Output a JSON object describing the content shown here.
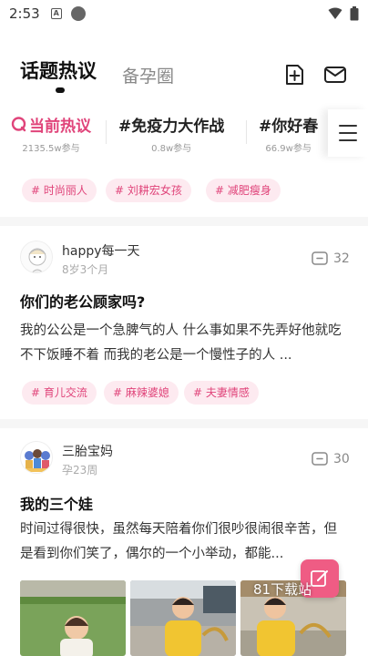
{
  "status_bar": {
    "time": "2:53",
    "a_badge": "A"
  },
  "header": {
    "active_tab": "话题热议",
    "second_tab": "备孕圈"
  },
  "topics": [
    {
      "title": "当前热议",
      "sub": "2135.5w参与"
    },
    {
      "title": "#免疫力大作战",
      "sub": "0.8w参与"
    },
    {
      "title": "#你好春",
      "sub": "66.9w参与"
    }
  ],
  "top_tags": [
    "# 时尚丽人",
    "# 刘耕宏女孩",
    "# 减肥瘦身"
  ],
  "posts": [
    {
      "author": "happy每一天",
      "sub": "8岁3个月",
      "comments": "32",
      "title": "你们的老公顾家吗?",
      "body": "我的公公是一个急脾气的人 什么事如果不先弄好他就吃不下饭睡不着 而我的老公是一个慢性子的人 ...",
      "tags": [
        "# 育儿交流",
        "# 麻辣婆媳",
        "# 夫妻情感"
      ]
    },
    {
      "author": "三胎宝妈",
      "sub": "孕23周",
      "comments": "30",
      "title": "我的三个娃",
      "body": "时间过得很快，虽然每天陪着你们很吵很闹很辛苦，但是看到你们笑了，偶尔的一个小举动，都能..."
    }
  ],
  "watermark": "81下载站",
  "colors": {
    "accent": "#e0447a",
    "tag_bg": "#fdeaf0",
    "fab": "#ef5c84"
  },
  "icons": [
    "wifi-icon",
    "battery-icon",
    "add-post-icon",
    "mail-icon",
    "menu-icon",
    "chat-icon",
    "edit-icon"
  ]
}
